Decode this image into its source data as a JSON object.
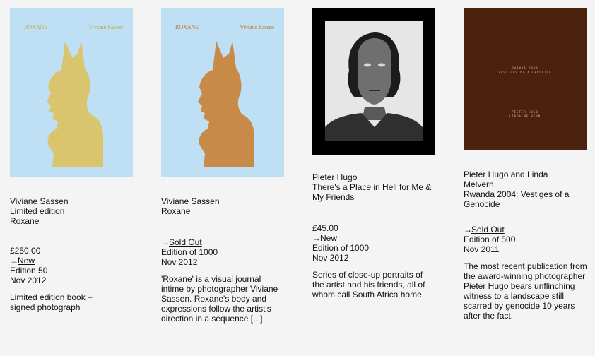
{
  "products": [
    {
      "artist": "Viviane Sassen",
      "subtitle": "Limited edition",
      "title": "Roxane",
      "price": "£250.00",
      "status": "New",
      "edition": "Edition 50",
      "date": "Nov 2012",
      "description": "Limited edition book + signed photograph",
      "cover": {
        "title": "ROXANE",
        "artist": "Viviane Sassen",
        "background": "#bfe0f4",
        "silhouette_color": "#d8c56e",
        "text_color": "#bda64e"
      }
    },
    {
      "artist": "Viviane Sassen",
      "title": "Roxane",
      "status": "Sold Out",
      "edition": "Edition of 1000",
      "date": "Nov 2012",
      "description": "'Roxane' is a visual journal intime by photographer Viviane Sassen. Roxane's body and expressions follow the artist's direction in a sequence [...]",
      "cover": {
        "title": "ROXANE",
        "artist": "Viviane Sassen",
        "background": "#bfe0f4",
        "silhouette_color": "#c78a47",
        "text_color": "#b8793a"
      }
    },
    {
      "artist": "Pieter Hugo",
      "title": "There's a Place in Hell for Me & My Friends",
      "price": "£45.00",
      "status": "New",
      "edition": "Edition of 1000",
      "date": "Nov 2012",
      "description": "Series of close-up portraits of the artist and his friends, all of whom call South Africa home.",
      "cover": {
        "background": "#000000",
        "image": "black-and-white close-up portrait of a man with pale eyes"
      }
    },
    {
      "artist": "Pieter Hugo and Linda Melvern",
      "title": "Rwanda 2004: Vestiges of a Genocide",
      "status": "Sold Out",
      "edition": "Edition of 500",
      "date": "Nov 2011",
      "description": "The most recent publication from the award-winning photographer Pieter Hugo bears unflinching witness to a landscape still scarred by genocide 10 years after the fact.",
      "cover": {
        "title_line1": "RWANDA 2004",
        "title_line2": "VESTIGES OF A GENOCIDE",
        "author_line1": "PIETER HUGO",
        "author_line2": "LINDA MELVERN",
        "background": "#4a220d",
        "text_color": "#d7b08e"
      }
    }
  ],
  "icons": {
    "status_arrow": "→"
  }
}
